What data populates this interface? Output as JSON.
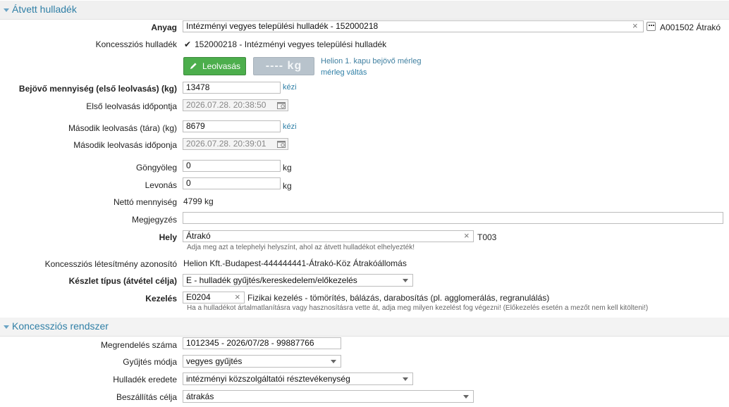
{
  "section_atvett": {
    "title": "Átvett hulladék"
  },
  "anyag": {
    "label": "Anyag",
    "value": "Intézményi vegyes települési hulladék - 152000218",
    "clear": "×",
    "code": "A001502 Átrakó"
  },
  "koncesszios_hulladek": {
    "label": "Koncessziós hulladék",
    "check": "✔",
    "value": "152000218 - Intézményi vegyes települési hulladék"
  },
  "scale": {
    "read_button": "Leolvasás",
    "display": "---- kg",
    "source": "Helion 1. kapu bejövő mérleg",
    "switch_link": "mérleg váltás"
  },
  "bejovo": {
    "label": "Bejövő mennyiség (első leolvasás) (kg)",
    "value": "13478",
    "mode": "kézi"
  },
  "elso_ido": {
    "label": "Első leolvasás időpontja",
    "value": "2026.07.28. 20:38:50"
  },
  "masodik": {
    "label": "Második leolvasás (tára) (kg)",
    "value": "8679",
    "mode": "kézi"
  },
  "masodik_ido": {
    "label": "Második leolvasás időponja",
    "value": "2026.07.28. 20:39:01"
  },
  "gongyoleg": {
    "label": "Göngyöleg",
    "value": "0",
    "unit": "kg"
  },
  "levonas": {
    "label": "Levonás",
    "value": "0",
    "unit": "kg"
  },
  "netto": {
    "label": "Nettó mennyiség",
    "value": "4799",
    "unit": "kg"
  },
  "megjegyzes": {
    "label": "Megjegyzés",
    "value": ""
  },
  "hely": {
    "label": "Hely",
    "value": "Átrakó",
    "clear": "×",
    "code": "T003",
    "hint": "Adja meg azt a telephelyi helyszínt, ahol az átvett hulladékot elhelyezték!"
  },
  "letesitmeny": {
    "label": "Koncessziós létesítmény azonosító",
    "value": "Helion Kft.-Budapest-444444441-Átrakó-Köz Átrakóállomás"
  },
  "keszlet": {
    "label": "Készlet típus (átvétel célja)",
    "value": "E - hulladék gyűjtés/kereskedelem/előkezelés"
  },
  "kezeles": {
    "label": "Kezelés",
    "code": "E0204",
    "clear": "×",
    "description": "Fizikai kezelés - tömörítés, bálázás, darabosítás (pl. agglomerálás, regranulálás)",
    "hint": "Ha a hulladékot ártalmatlanításra vagy hasznosításra vette át, adja meg milyen kezelést fog végezni! (Előkezelés esetén a mezőt nem kell kitölteni!)"
  },
  "section_koncesszios": {
    "title": "Koncessziós rendszer"
  },
  "megrendeles": {
    "label": "Megrendelés száma",
    "value": "1012345 - 2026/07/28 - 99887766"
  },
  "gyujtes": {
    "label": "Gyűjtés módja",
    "value": "vegyes gyűjtés"
  },
  "eredet": {
    "label": "Hulladék eredete",
    "value": "intézményi közszolgáltatói résztevékenység"
  },
  "beszallitas": {
    "label": "Beszállítás célja",
    "value": "átrakás"
  },
  "colors": {
    "accent": "#2f7fa6",
    "button_green": "#4cae4c",
    "scale_bg": "#b8c3cc"
  }
}
